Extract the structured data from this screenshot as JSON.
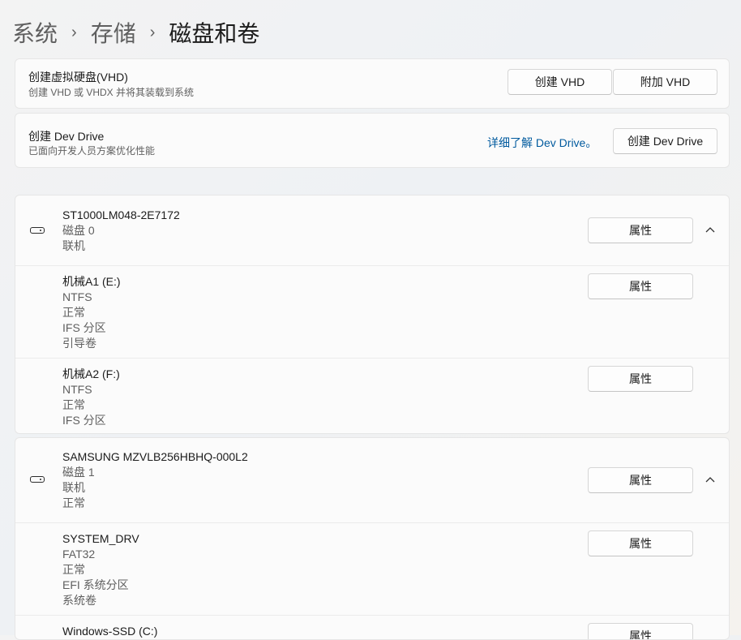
{
  "breadcrumb": {
    "items": [
      "系统",
      "存储",
      "磁盘和卷"
    ]
  },
  "vhd_card": {
    "title": "创建虚拟硬盘(VHD)",
    "subtitle": "创建 VHD 或 VHDX 并将其装载到系统",
    "create_btn": "创建 VHD",
    "attach_btn": "附加 VHD"
  },
  "devdrive_card": {
    "title": "创建 Dev Drive",
    "subtitle": "已面向开发人员方案优化性能",
    "link": "详细了解 Dev Drive。",
    "create_btn": "创建 Dev Drive"
  },
  "properties_label": "属性",
  "disks": [
    {
      "name": "ST1000LM048-2E7172",
      "lines": [
        "磁盘 0",
        "联机"
      ],
      "volumes": [
        {
          "name": "机械A1 (E:)",
          "lines": [
            "NTFS",
            "正常",
            "IFS 分区",
            "引导卷"
          ]
        },
        {
          "name": "机械A2 (F:)",
          "lines": [
            "NTFS",
            "正常",
            "IFS 分区"
          ]
        }
      ]
    },
    {
      "name": "SAMSUNG MZVLB256HBHQ-000L2",
      "lines": [
        "磁盘 1",
        "联机",
        "正常"
      ],
      "volumes": [
        {
          "name": "SYSTEM_DRV",
          "lines": [
            "FAT32",
            "正常",
            "EFI 系统分区",
            "系统卷"
          ]
        },
        {
          "name": "Windows-SSD (C:)",
          "lines": []
        }
      ]
    }
  ],
  "icons": {
    "drive": "hard-drive-icon",
    "chevron": "chevron-up-icon",
    "separator": "chevron-right-icon"
  }
}
